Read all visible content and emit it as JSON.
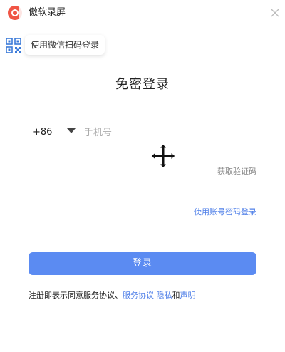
{
  "app": {
    "title": "傲软录屏",
    "logo_icon": "record-logo-icon",
    "brand_color": "#f05545"
  },
  "qr_login": {
    "label": "使用微信扫码登录",
    "icon": "qr-code-icon"
  },
  "form": {
    "title": "免密登录",
    "country_code": "+86",
    "phone_placeholder": "手机号",
    "phone_value": "",
    "code_value": "",
    "get_code_label": "获取验证码",
    "account_login_link": "使用账号密码登录",
    "submit_label": "登录"
  },
  "agreement": {
    "prefix": "注册即表示同意服务协议、",
    "service_link": "服务协议",
    "privacy_link": "隐私",
    "connector": "和",
    "statement_link": "声明"
  },
  "colors": {
    "accent": "#5b8bf2",
    "link": "#4f7fe8"
  }
}
